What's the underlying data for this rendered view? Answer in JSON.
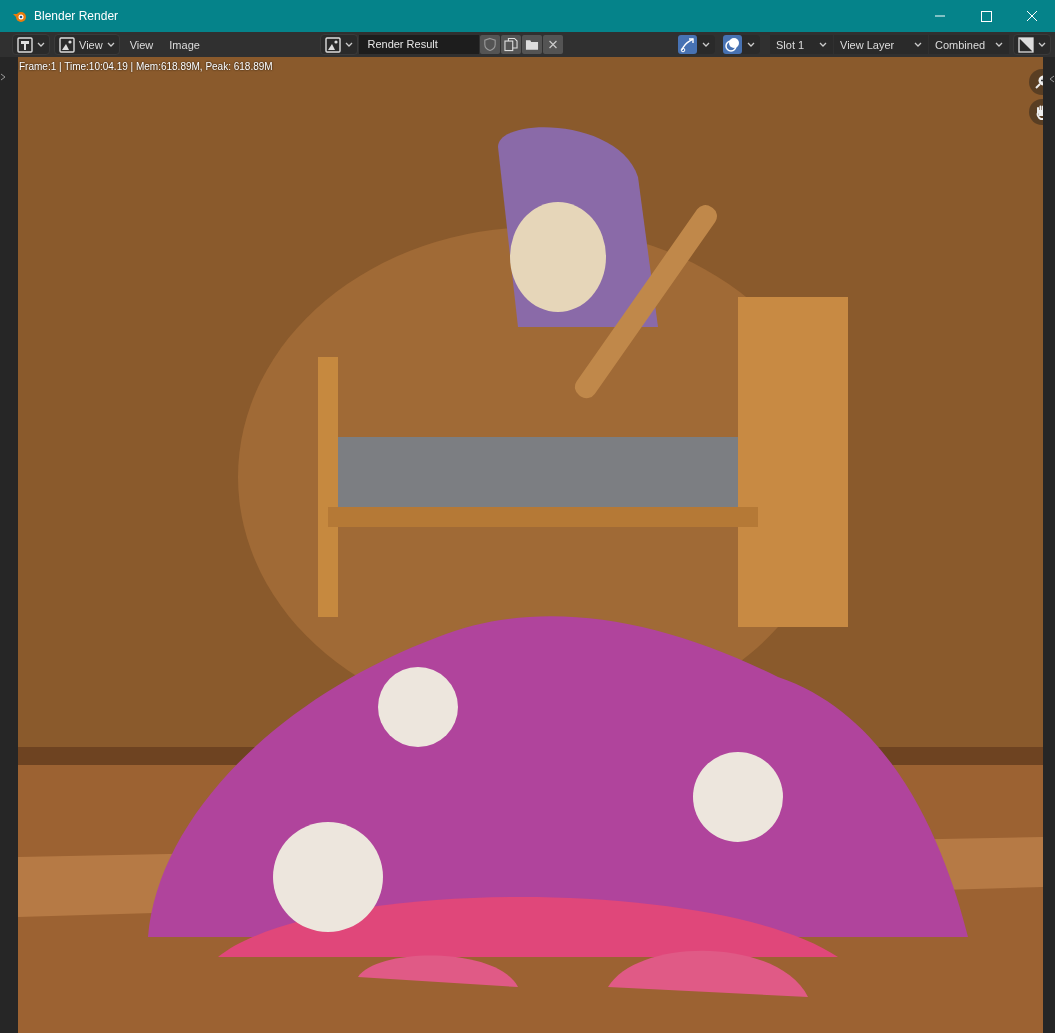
{
  "window": {
    "title": "Blender Render"
  },
  "header": {
    "editor_menu": {
      "kind": "editor"
    },
    "view_dropdown": {
      "label": "View"
    },
    "menus": [
      "View",
      "Image"
    ],
    "image_field": {
      "value": "Render Result"
    },
    "toggles": [
      {
        "kind": "curve",
        "on": true
      },
      {
        "kind": "overlay",
        "on": true
      }
    ],
    "dropdowns": [
      {
        "label": "Slot 1"
      },
      {
        "label": "View Layer"
      },
      {
        "label": "Combined"
      }
    ]
  },
  "viewport": {
    "info": "Frame:1 | Time:10:04.19 | Mem:618.89M, Peak: 618.89M"
  }
}
